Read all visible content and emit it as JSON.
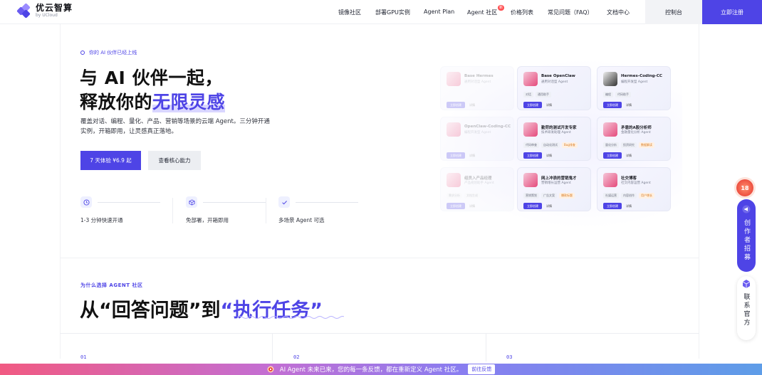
{
  "brand": {
    "name": "优云智算",
    "sub": "by UCloud"
  },
  "nav": {
    "items": [
      "镜像社区",
      "部署GPU实例",
      "Agent Plan",
      "Agent 社区",
      "价格列表",
      "常见问题（FAQ）",
      "文档中心"
    ],
    "new_badge": "新",
    "console": "控制台",
    "register": "立即注册"
  },
  "hero": {
    "tagline": "你的 AI 伙伴已经上线",
    "title_line1": "与 AI 伙伴一起，",
    "title_line2_prefix": "释放你的",
    "title_line2_accent": "无限灵感",
    "desc": "覆盖对话、编程、量化、产品、营销等场景的云端 Agent。三分钟开通实例，开箱即用，让灵感真正落地。",
    "cta_primary": "7 天体验 ¥6.9 起",
    "cta_secondary": "查看核心能力",
    "features": [
      {
        "label": "1-3 分钟快速开通",
        "icon": "clock-icon"
      },
      {
        "label": "免部署，开箱即用",
        "icon": "cube-icon"
      },
      {
        "label": "多场景 Agent 可选",
        "icon": "check-icon"
      }
    ]
  },
  "cards": [
    {
      "title": "Base Hermes",
      "sub": "通用对话型 Agent",
      "tags": [],
      "primary": "立即创建",
      "secondary": "详情"
    },
    {
      "title": "Base OpenClaw",
      "sub": "通用对话型 Agent",
      "tags": [
        "对话",
        "通用助手"
      ],
      "primary": "立即创建",
      "secondary": "详情"
    },
    {
      "title": "Hermes-Coding-CC",
      "sub": "编程开发型 Agent",
      "tags": [
        "编程",
        "代码助手"
      ],
      "primary": "立即创建",
      "secondary": "详情"
    },
    {
      "title": "OpenClaw-Coding-CC",
      "sub": "编程开发型 Agent",
      "tags": [],
      "primary": "立即创建",
      "secondary": "详情"
    },
    {
      "title": "勤劳的测试开发专家",
      "sub": "技术研发助理 Agent",
      "tags": [
        "代码审查",
        "自动化测试",
        "Bug排查"
      ],
      "primary": "立即创建",
      "secondary": "详情"
    },
    {
      "title": "矛盾的A股分析师",
      "sub": "金融量化分析 Agent",
      "tags": [
        "量化分析",
        "投资研究",
        "数据解读"
      ],
      "primary": "立即创建",
      "secondary": "详情"
    },
    {
      "title": "组员入产品经理",
      "sub": "产品规划助手 Agent",
      "tags": [
        "需求分析",
        "文档生成"
      ],
      "primary": "立即创建",
      "secondary": "详情"
    },
    {
      "title": "网上冲浪的营销鬼才",
      "sub": "营销增长运营 Agent",
      "tags": [
        "营销策划",
        "广告文案",
        "爆款标题"
      ],
      "primary": "立即创建",
      "secondary": "详情"
    },
    {
      "title": "社交博客",
      "sub": "社交内容运营 Agent",
      "tags": [
        "社媒运营",
        "内容创作",
        "用户增长"
      ],
      "primary": "立即创建",
      "secondary": "详情"
    }
  ],
  "section2": {
    "kicker": "为什么选择 AGENT 社区",
    "title_prefix": "从“回答问题”到",
    "title_accent": "“执行任务”",
    "cols": [
      "01",
      "02",
      "03"
    ]
  },
  "floats": {
    "badge": "18",
    "recruit": "创作者招募",
    "contact": "联系官方"
  },
  "bottom_bar": {
    "text": "AI Agent 未来已来，您的每一条反馈，都在重新定义 Agent 社区。",
    "button": "前往反馈"
  },
  "colors": {
    "accent": "#4e44e6"
  }
}
